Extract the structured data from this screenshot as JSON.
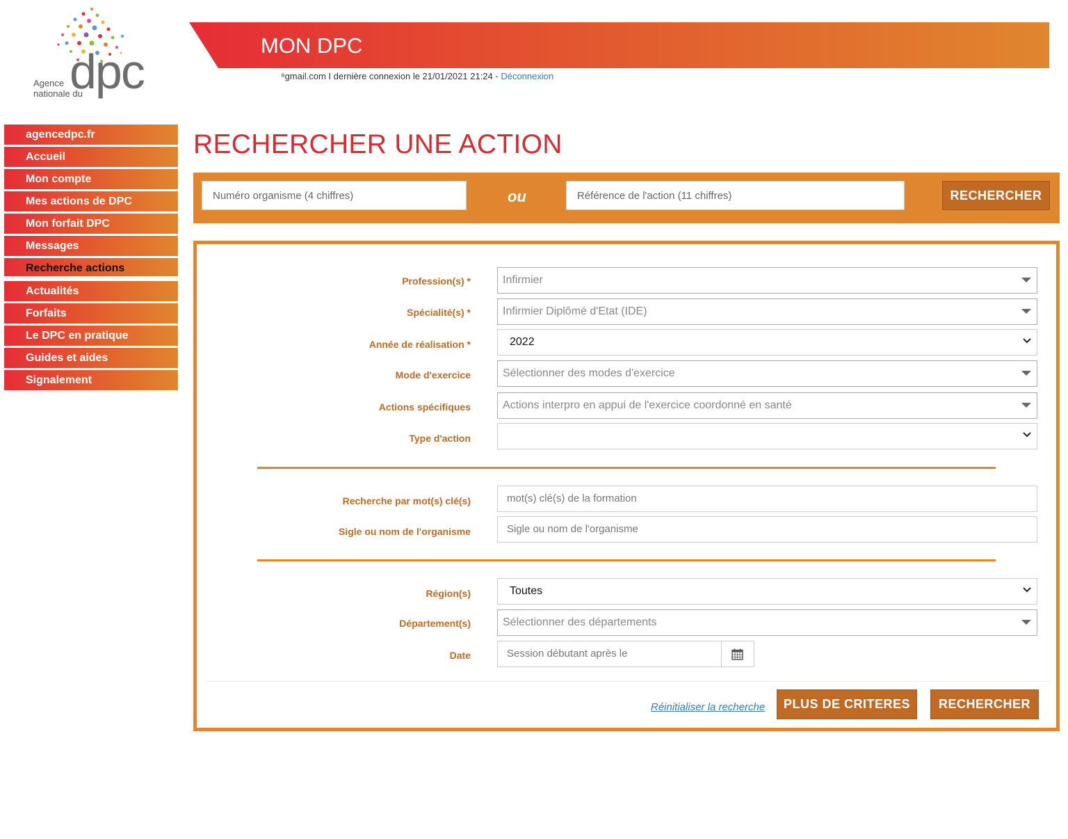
{
  "logo": {
    "line1": "Agence",
    "line2": "nationale du",
    "brand": "dpc"
  },
  "header": {
    "title": "MON DPC",
    "user_text": "⁹gmail.com I dernière connexion le 21/01/2021 21:24 - ",
    "logout": "Déconnexion"
  },
  "sidebar": {
    "items": [
      {
        "label": "agencedpc.fr"
      },
      {
        "label": "Accueil"
      },
      {
        "label": "Mon compte"
      },
      {
        "label": "Mes actions de DPC"
      },
      {
        "label": "Mon forfait DPC"
      },
      {
        "label": "Messages"
      },
      {
        "label": "Recherche actions"
      },
      {
        "label": "Actualités"
      },
      {
        "label": "Forfaits"
      },
      {
        "label": "Le DPC en pratique"
      },
      {
        "label": "Guides et aides"
      },
      {
        "label": "Signalement"
      }
    ],
    "active": "Recherche actions"
  },
  "page": {
    "title": "RECHERCHER UNE ACTION"
  },
  "quick": {
    "num_placeholder": "Numéro organisme (4 chiffres)",
    "or": "ou",
    "ref_placeholder": "Référence de l'action (11 chiffres)",
    "button": "RECHERCHER"
  },
  "form": {
    "profession": {
      "label": "Profession(s) *",
      "value": "Infirmier"
    },
    "specialite": {
      "label": "Spécialité(s) *",
      "value": "Infirmier Diplômé d'Etat (IDE)"
    },
    "annee": {
      "label": "Année de réalisation *",
      "value": "2022"
    },
    "mode": {
      "label": "Mode d'exercice",
      "value": "Sélectionner des modes d'exercice"
    },
    "actions_spec": {
      "label": "Actions spécifiques",
      "value": "Actions interpro en appui de l'exercice coordonné en santé"
    },
    "type": {
      "label": "Type d'action",
      "value": ""
    },
    "motcle": {
      "label": "Recherche par mot(s) clé(s)",
      "placeholder": "mot(s) clé(s) de la formation"
    },
    "organisme": {
      "label": "Sigle ou nom de l'organisme",
      "placeholder": "Sigle ou nom de l'organisme"
    },
    "region": {
      "label": "Région(s)",
      "value": "Toutes"
    },
    "departement": {
      "label": "Département(s)",
      "value": "Sélectionner des départements"
    },
    "date": {
      "label": "Date",
      "placeholder": "Session débutant après le"
    },
    "reset": "Réinitialiser la recherche",
    "more": "PLUS DE CRITERES",
    "search": "RECHERCHER"
  },
  "colors": {
    "red": "#e52d36",
    "orange": "#e0862e",
    "dark_orange": "#c06a24",
    "link": "#2e7fc1"
  }
}
